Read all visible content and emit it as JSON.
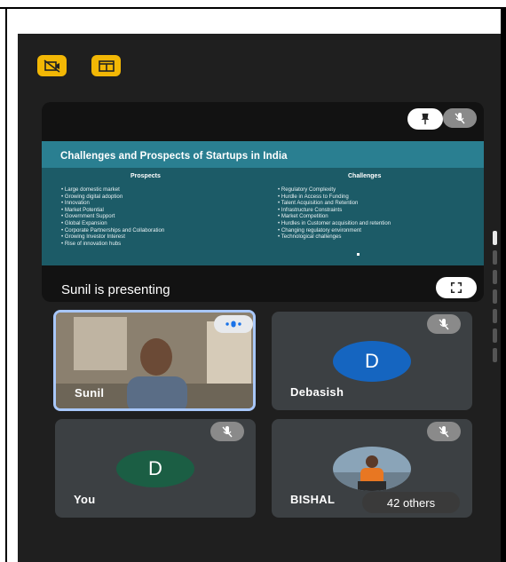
{
  "presentation": {
    "slide": {
      "title": "Challenges and Prospects of Startups in India",
      "left_heading": "Prospects",
      "left_items": [
        "Large domestic market",
        "Growing digital adoption",
        "Innovation",
        "Market Potential",
        "Government Support",
        "Global Expansion",
        "Corporate Partnerships and Collaboration",
        "Growing Investor Interest",
        "Rise of innovation hubs"
      ],
      "right_heading": "Challenges",
      "right_items": [
        "Regulatory Complexity",
        "Hurdle in Access to Funding",
        "Talent Acquisition and Retention",
        "Infrastructure Constraints",
        "Market Competition",
        "Hurdles in Customer acquisition and retention",
        "Changing regulatory environment",
        "Technological challenges"
      ]
    },
    "presenter_label": "Sunil is presenting"
  },
  "participants": [
    {
      "name": "Sunil",
      "initial": ""
    },
    {
      "name": "Debasish",
      "initial": "D"
    },
    {
      "name": "You",
      "initial": "D"
    },
    {
      "name": "BISHAL",
      "initial": ""
    }
  ],
  "others_label": "42 others",
  "icons": {
    "top_left": "camera-off-icon",
    "top_right": "switch-view-icon",
    "pin": "pin-icon",
    "muted": "mic-off-icon",
    "fullscreen": "fullscreen-icon"
  },
  "colors": {
    "accent": "#f2b705",
    "tile": "#3c4043",
    "debasish_avatar": "#1565c0",
    "you_avatar": "#1b5e44"
  }
}
